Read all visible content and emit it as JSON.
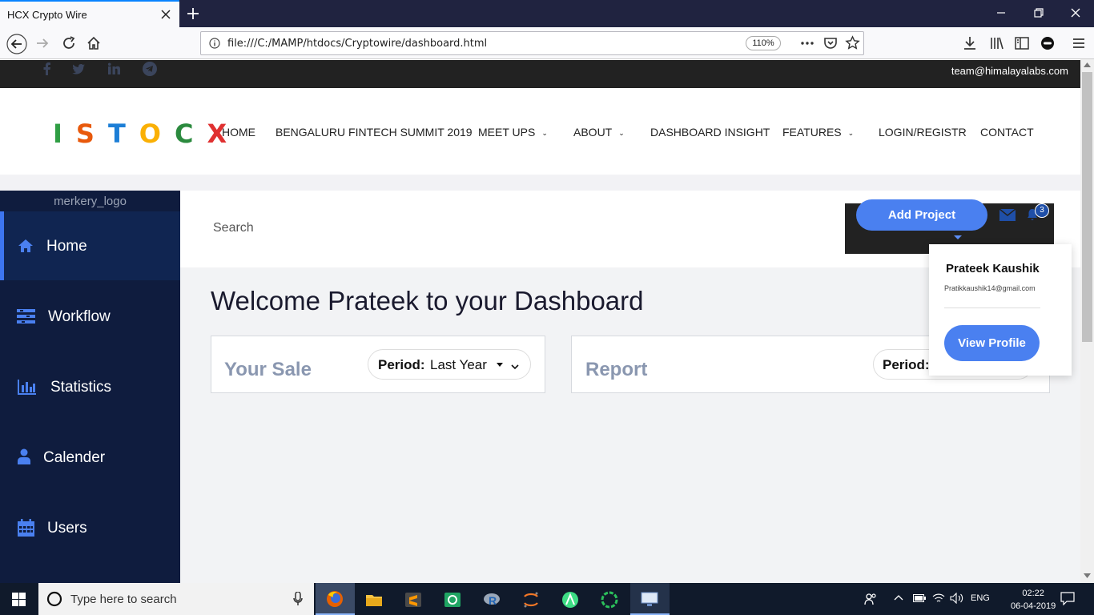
{
  "browser": {
    "tab_title": "HCX Crypto Wire",
    "url": "file:///C:/MAMP/htdocs/Cryptowire/dashboard.html",
    "zoom": "110%"
  },
  "topbar": {
    "email": "team@himalayalabs.com"
  },
  "logo": {
    "letters": [
      {
        "char": "I",
        "color": "#2f9e44"
      },
      {
        "char": "S",
        "color": "#e8590c"
      },
      {
        "char": "T",
        "color": "#1c7ed6"
      },
      {
        "char": "O",
        "color": "#fab005"
      },
      {
        "char": "C",
        "color": "#2b8a3e"
      },
      {
        "char": "X",
        "color": "#e03131"
      }
    ]
  },
  "nav": {
    "home": "HOME",
    "summit": "BENGALURU FINTECH SUMMIT 2019",
    "meetups": "MEET UPS",
    "about": "ABOUT",
    "dashboard": "DASHBOARD INSIGHT",
    "features": "FEATURES",
    "login": "LOGIN/REGISTR",
    "contact": "CONTACT"
  },
  "sidebar": {
    "brand": "merkery_logo",
    "items": [
      {
        "label": "Home",
        "icon": "home-icon"
      },
      {
        "label": "Workflow",
        "icon": "workflow-icon"
      },
      {
        "label": "Statistics",
        "icon": "bar-chart-icon"
      },
      {
        "label": "Calender",
        "icon": "user-icon"
      },
      {
        "label": "Users",
        "icon": "calendar-icon"
      }
    ]
  },
  "search": {
    "placeholder": "Search"
  },
  "actions": {
    "add_project": "Add Project",
    "notification_count": "3"
  },
  "main": {
    "welcome": "Welcome Prateek to your Dashboard"
  },
  "cards": {
    "sale_title": "Your Sale",
    "period_label": "Period:",
    "period_value": "Last Year",
    "report_title": "Report"
  },
  "profile": {
    "name": "Prateek Kaushik",
    "email": "Pratikkaushik14@gmail.com",
    "view_profile": "View Profile"
  },
  "taskbar": {
    "search_placeholder": "Type here to search",
    "language": "ENG",
    "time": "02:22",
    "date": "06-04-2019"
  },
  "colors": {
    "accent": "#4a80f0",
    "sidebar": "#0f1c3e",
    "sidebar_active": "#102551"
  }
}
